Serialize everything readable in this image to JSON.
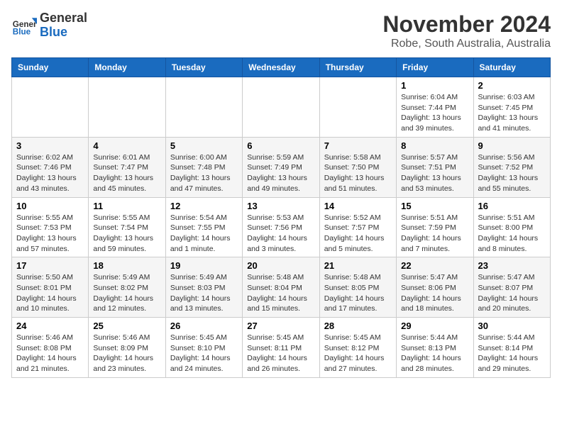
{
  "logo": {
    "general": "General",
    "blue": "Blue"
  },
  "header": {
    "month": "November 2024",
    "location": "Robe, South Australia, Australia"
  },
  "weekdays": [
    "Sunday",
    "Monday",
    "Tuesday",
    "Wednesday",
    "Thursday",
    "Friday",
    "Saturday"
  ],
  "weeks": [
    [
      {
        "day": "",
        "detail": ""
      },
      {
        "day": "",
        "detail": ""
      },
      {
        "day": "",
        "detail": ""
      },
      {
        "day": "",
        "detail": ""
      },
      {
        "day": "",
        "detail": ""
      },
      {
        "day": "1",
        "detail": "Sunrise: 6:04 AM\nSunset: 7:44 PM\nDaylight: 13 hours\nand 39 minutes."
      },
      {
        "day": "2",
        "detail": "Sunrise: 6:03 AM\nSunset: 7:45 PM\nDaylight: 13 hours\nand 41 minutes."
      }
    ],
    [
      {
        "day": "3",
        "detail": "Sunrise: 6:02 AM\nSunset: 7:46 PM\nDaylight: 13 hours\nand 43 minutes."
      },
      {
        "day": "4",
        "detail": "Sunrise: 6:01 AM\nSunset: 7:47 PM\nDaylight: 13 hours\nand 45 minutes."
      },
      {
        "day": "5",
        "detail": "Sunrise: 6:00 AM\nSunset: 7:48 PM\nDaylight: 13 hours\nand 47 minutes."
      },
      {
        "day": "6",
        "detail": "Sunrise: 5:59 AM\nSunset: 7:49 PM\nDaylight: 13 hours\nand 49 minutes."
      },
      {
        "day": "7",
        "detail": "Sunrise: 5:58 AM\nSunset: 7:50 PM\nDaylight: 13 hours\nand 51 minutes."
      },
      {
        "day": "8",
        "detail": "Sunrise: 5:57 AM\nSunset: 7:51 PM\nDaylight: 13 hours\nand 53 minutes."
      },
      {
        "day": "9",
        "detail": "Sunrise: 5:56 AM\nSunset: 7:52 PM\nDaylight: 13 hours\nand 55 minutes."
      }
    ],
    [
      {
        "day": "10",
        "detail": "Sunrise: 5:55 AM\nSunset: 7:53 PM\nDaylight: 13 hours\nand 57 minutes."
      },
      {
        "day": "11",
        "detail": "Sunrise: 5:55 AM\nSunset: 7:54 PM\nDaylight: 13 hours\nand 59 minutes."
      },
      {
        "day": "12",
        "detail": "Sunrise: 5:54 AM\nSunset: 7:55 PM\nDaylight: 14 hours\nand 1 minute."
      },
      {
        "day": "13",
        "detail": "Sunrise: 5:53 AM\nSunset: 7:56 PM\nDaylight: 14 hours\nand 3 minutes."
      },
      {
        "day": "14",
        "detail": "Sunrise: 5:52 AM\nSunset: 7:57 PM\nDaylight: 14 hours\nand 5 minutes."
      },
      {
        "day": "15",
        "detail": "Sunrise: 5:51 AM\nSunset: 7:59 PM\nDaylight: 14 hours\nand 7 minutes."
      },
      {
        "day": "16",
        "detail": "Sunrise: 5:51 AM\nSunset: 8:00 PM\nDaylight: 14 hours\nand 8 minutes."
      }
    ],
    [
      {
        "day": "17",
        "detail": "Sunrise: 5:50 AM\nSunset: 8:01 PM\nDaylight: 14 hours\nand 10 minutes."
      },
      {
        "day": "18",
        "detail": "Sunrise: 5:49 AM\nSunset: 8:02 PM\nDaylight: 14 hours\nand 12 minutes."
      },
      {
        "day": "19",
        "detail": "Sunrise: 5:49 AM\nSunset: 8:03 PM\nDaylight: 14 hours\nand 13 minutes."
      },
      {
        "day": "20",
        "detail": "Sunrise: 5:48 AM\nSunset: 8:04 PM\nDaylight: 14 hours\nand 15 minutes."
      },
      {
        "day": "21",
        "detail": "Sunrise: 5:48 AM\nSunset: 8:05 PM\nDaylight: 14 hours\nand 17 minutes."
      },
      {
        "day": "22",
        "detail": "Sunrise: 5:47 AM\nSunset: 8:06 PM\nDaylight: 14 hours\nand 18 minutes."
      },
      {
        "day": "23",
        "detail": "Sunrise: 5:47 AM\nSunset: 8:07 PM\nDaylight: 14 hours\nand 20 minutes."
      }
    ],
    [
      {
        "day": "24",
        "detail": "Sunrise: 5:46 AM\nSunset: 8:08 PM\nDaylight: 14 hours\nand 21 minutes."
      },
      {
        "day": "25",
        "detail": "Sunrise: 5:46 AM\nSunset: 8:09 PM\nDaylight: 14 hours\nand 23 minutes."
      },
      {
        "day": "26",
        "detail": "Sunrise: 5:45 AM\nSunset: 8:10 PM\nDaylight: 14 hours\nand 24 minutes."
      },
      {
        "day": "27",
        "detail": "Sunrise: 5:45 AM\nSunset: 8:11 PM\nDaylight: 14 hours\nand 26 minutes."
      },
      {
        "day": "28",
        "detail": "Sunrise: 5:45 AM\nSunset: 8:12 PM\nDaylight: 14 hours\nand 27 minutes."
      },
      {
        "day": "29",
        "detail": "Sunrise: 5:44 AM\nSunset: 8:13 PM\nDaylight: 14 hours\nand 28 minutes."
      },
      {
        "day": "30",
        "detail": "Sunrise: 5:44 AM\nSunset: 8:14 PM\nDaylight: 14 hours\nand 29 minutes."
      }
    ]
  ]
}
